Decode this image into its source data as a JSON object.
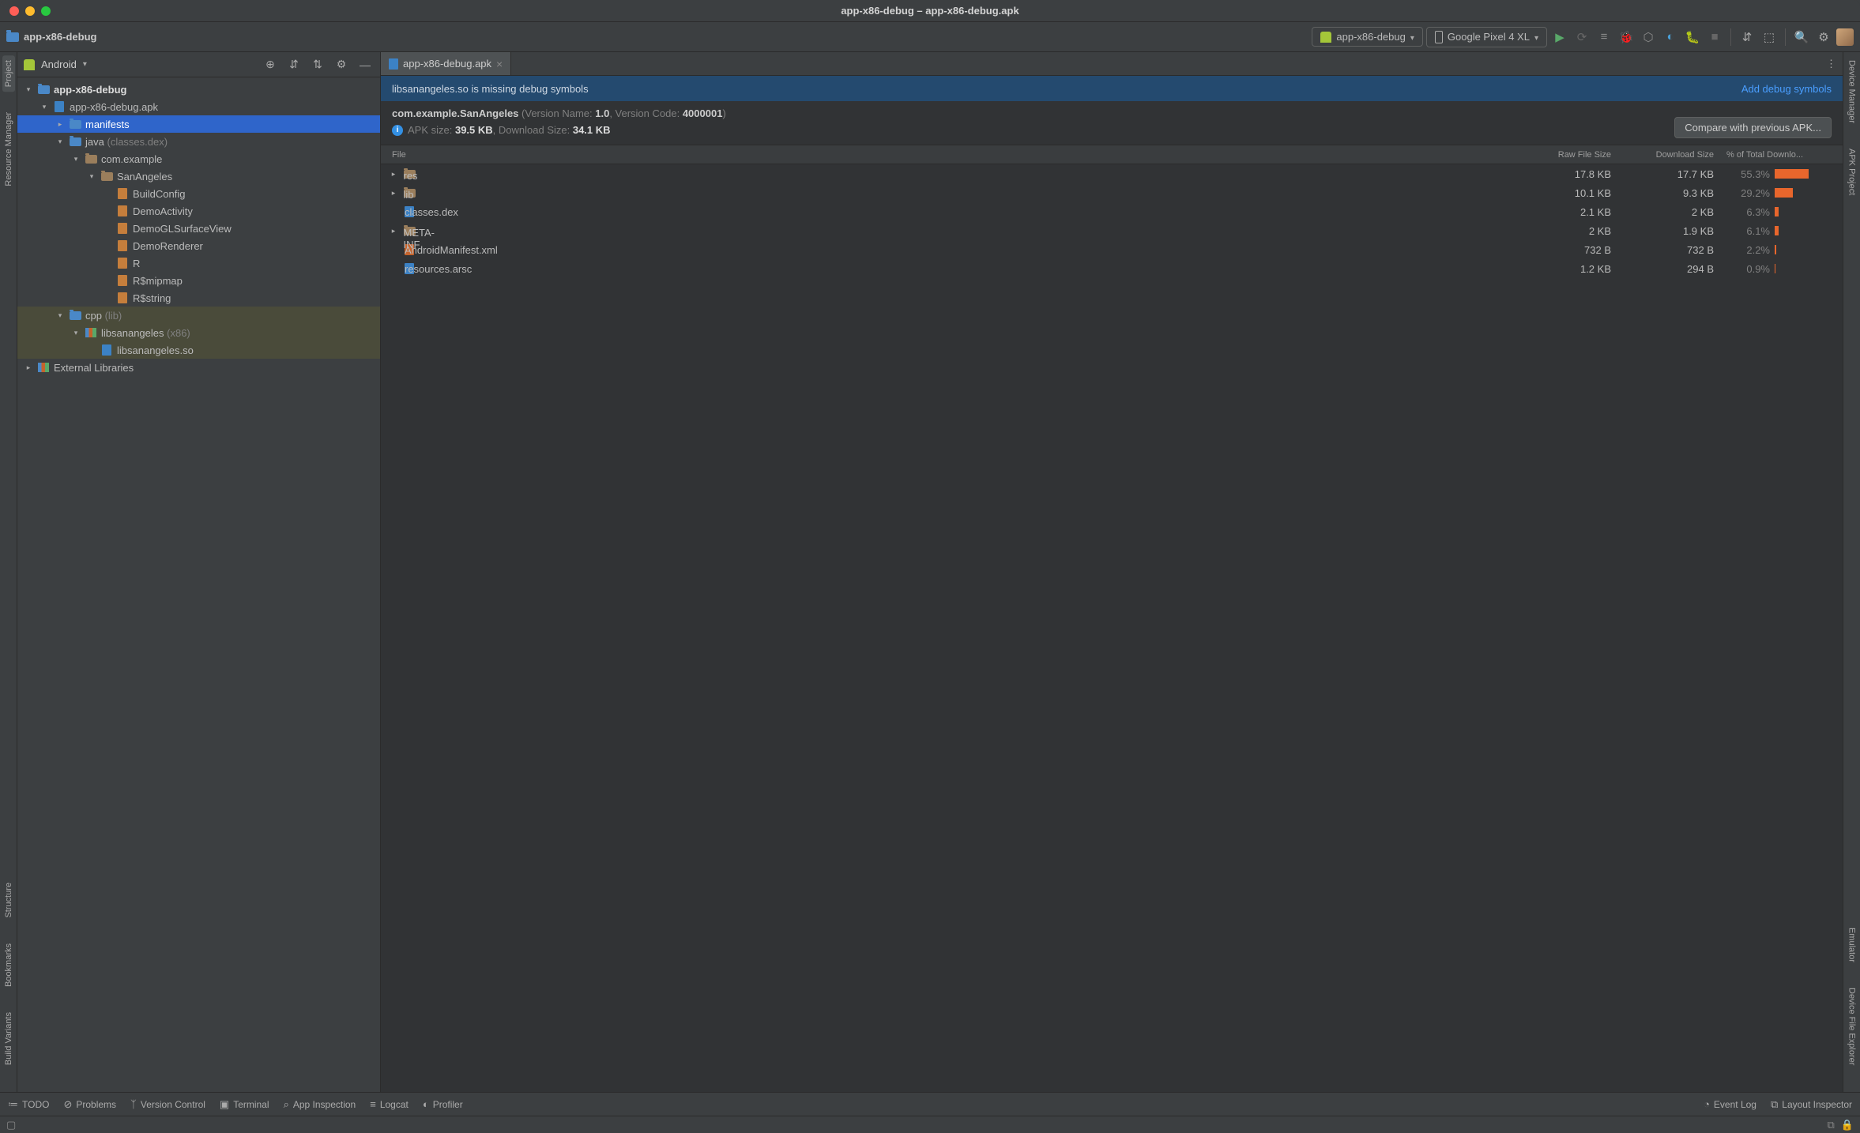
{
  "window": {
    "title": "app-x86-debug – app-x86-debug.apk"
  },
  "breadcrumb": "app-x86-debug",
  "run_config": "app-x86-debug",
  "device": "Google Pixel 4 XL",
  "panel": {
    "view": "Android"
  },
  "tree": {
    "root": "app-x86-debug",
    "apk": "app-x86-debug.apk",
    "manifests": "manifests",
    "java": "java",
    "java_suffix": "(classes.dex)",
    "pkg": "com.example",
    "cls": "SanAngeles",
    "files": [
      "BuildConfig",
      "DemoActivity",
      "DemoGLSurfaceView",
      "DemoRenderer",
      "R",
      "R$mipmap",
      "R$string"
    ],
    "cpp": "cpp",
    "cpp_suffix": "(lib)",
    "nativelib": "libsanangeles",
    "nativelib_suffix": "(x86)",
    "so": "libsanangeles.so",
    "ext": "External Libraries"
  },
  "editor": {
    "tab": "app-x86-debug.apk",
    "banner_msg": "libsanangeles.so is missing debug symbols",
    "banner_action": "Add debug symbols",
    "package": "com.example.SanAngeles",
    "version_label": "(Version Name: ",
    "version_name": "1.0",
    "version_code_label": ", Version Code: ",
    "version_code": "4000001",
    "version_close": ")",
    "apk_label": "APK size: ",
    "apk_size": "39.5 KB",
    "dl_label": ", Download Size: ",
    "dl_size": "34.1 KB",
    "compare": "Compare with previous APK...",
    "columns": {
      "file": "File",
      "raw": "Raw File Size",
      "dl": "Download Size",
      "pct": "% of Total Downlo..."
    },
    "rows": [
      {
        "name": "res",
        "type": "folder",
        "raw": "17.8 KB",
        "dl": "17.7 KB",
        "pct": "55.3%",
        "bar": 55.3,
        "expandable": true
      },
      {
        "name": "lib",
        "type": "folder",
        "raw": "10.1 KB",
        "dl": "9.3 KB",
        "pct": "29.2%",
        "bar": 29.2,
        "expandable": true
      },
      {
        "name": "classes.dex",
        "type": "arsc",
        "raw": "2.1 KB",
        "dl": "2 KB",
        "pct": "6.3%",
        "bar": 6.3,
        "expandable": false
      },
      {
        "name": "META-INF",
        "type": "folder",
        "raw": "2 KB",
        "dl": "1.9 KB",
        "pct": "6.1%",
        "bar": 6.1,
        "expandable": true
      },
      {
        "name": "AndroidManifest.xml",
        "type": "xml",
        "raw": "732 B",
        "dl": "732 B",
        "pct": "2.2%",
        "bar": 2.2,
        "expandable": false
      },
      {
        "name": "resources.arsc",
        "type": "arsc",
        "raw": "1.2 KB",
        "dl": "294 B",
        "pct": "0.9%",
        "bar": 0.9,
        "expandable": false
      }
    ]
  },
  "left_tabs": [
    "Project",
    "Resource Manager",
    "Structure",
    "Bookmarks",
    "Build Variants"
  ],
  "right_tabs": [
    "Device Manager",
    "APK Project",
    "Emulator",
    "Device File Explorer"
  ],
  "status": {
    "todo": "TODO",
    "problems": "Problems",
    "vc": "Version Control",
    "terminal": "Terminal",
    "inspect": "App Inspection",
    "logcat": "Logcat",
    "profiler": "Profiler",
    "eventlog": "Event Log",
    "layout": "Layout Inspector"
  }
}
